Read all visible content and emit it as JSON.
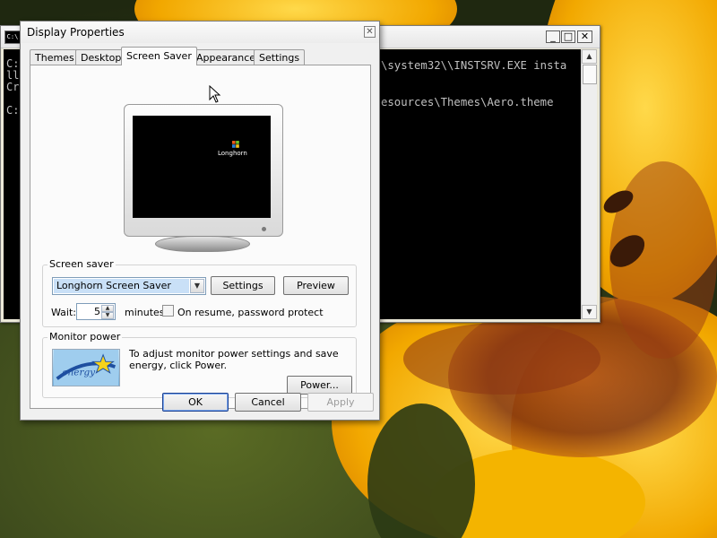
{
  "console": {
    "icon_text": "C:\\",
    "minimize_glyph": "_",
    "maximize_glyph": "□",
    "close_glyph": "✕",
    "left_lines": "C:\nll\nCr\n\nC:",
    "right_lines": "\\system32\\\\INSTSRV.EXE insta\n\n\nesources\\Themes\\Aero.theme"
  },
  "dialog": {
    "title": "Display Properties",
    "close_glyph": "✕",
    "tabs": [
      {
        "label": "Themes"
      },
      {
        "label": "Desktop"
      },
      {
        "label": "Screen Saver"
      },
      {
        "label": "Appearance"
      },
      {
        "label": "Settings"
      }
    ],
    "active_tab": "Screen Saver",
    "preview": {
      "logo_text": "Longhorn"
    },
    "screen_saver_group": {
      "label": "Screen saver",
      "selected": "Longhorn Screen Saver",
      "settings_button": "Settings",
      "preview_button": "Preview",
      "wait_label": "Wait:",
      "wait_value": "5",
      "minutes_label": "minutes",
      "password_label": "On resume, password protect",
      "password_checked": false
    },
    "monitor_power_group": {
      "label": "Monitor power",
      "description": "To adjust monitor power settings and save energy, click Power.",
      "power_button": "Power...",
      "logo_text": "energy"
    },
    "buttons": {
      "ok": "OK",
      "cancel": "Cancel",
      "apply": "Apply"
    }
  },
  "colors": {
    "accent": "#1a3f8f",
    "console_bg": "#000000",
    "selection": "#c9e0f7"
  }
}
